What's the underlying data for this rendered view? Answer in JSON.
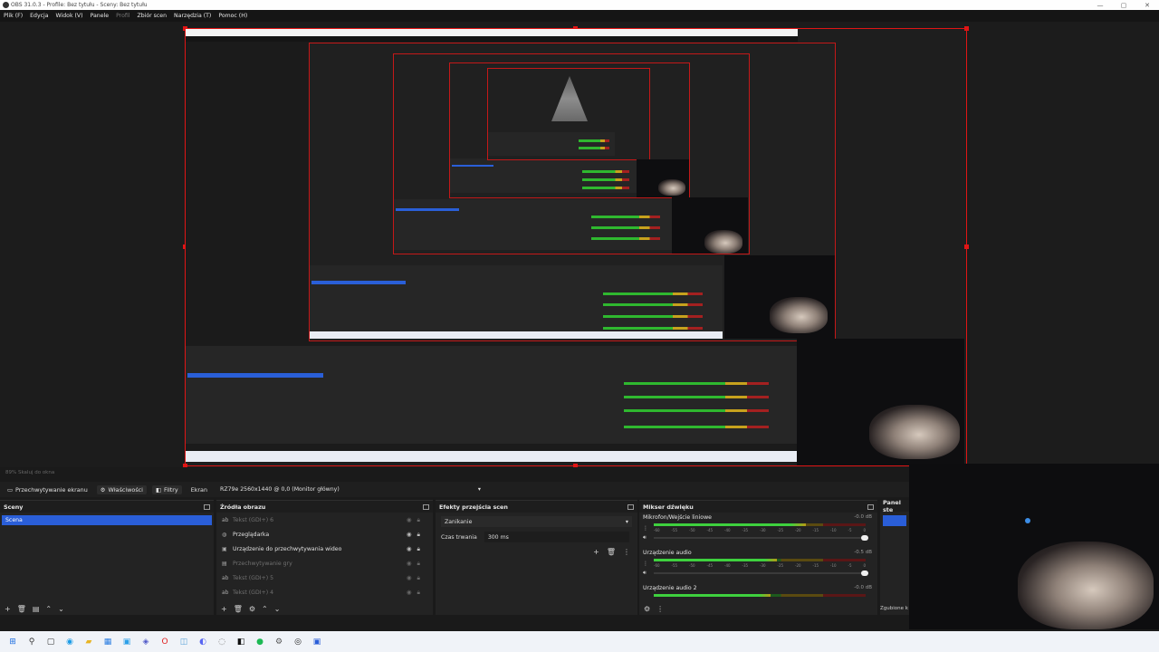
{
  "window": {
    "title": "OBS 31.0.3 - Profile: Bez tytułu - Sceny: Bez tytułu",
    "controls": [
      "—",
      "▢",
      "✕"
    ]
  },
  "menu": {
    "items": [
      "Plik (F)",
      "Edycja",
      "Widok (V)",
      "Panele",
      "Profil",
      "Zbiór scen",
      "Narzędzia (T)",
      "Pomoc (H)"
    ]
  },
  "status_line": "89%   Skaluj do okna",
  "source_toolbar": {
    "source_name": "Przechwytywanie ekranu",
    "properties_label": "Właściwości",
    "filters_label": "Filtry",
    "screen_label": "Ekran",
    "monitor_value": "RZ79e 2560x1440 @ 0,0 (Monitor główny)"
  },
  "scenes": {
    "title": "Sceny",
    "items": [
      "Scena"
    ],
    "footer": [
      "+",
      "🗑",
      "▤",
      "⌃",
      "⌄"
    ]
  },
  "sources": {
    "title": "Źródła obrazu",
    "items": [
      {
        "label": "Tekst (GDI+) 6",
        "dim": true,
        "icon": "text-icon"
      },
      {
        "label": "Przeglądarka",
        "dim": false,
        "icon": "browser-icon"
      },
      {
        "label": "Urządzenie do przechwytywania wideo",
        "dim": false,
        "icon": "camera-icon"
      },
      {
        "label": "Przechwytywanie gry",
        "dim": true,
        "icon": "gamepad-icon"
      },
      {
        "label": "Tekst (GDI+) 5",
        "dim": true,
        "icon": "text-icon"
      },
      {
        "label": "Tekst (GDI+) 4",
        "dim": true,
        "icon": "text-icon"
      }
    ],
    "footer": [
      "+",
      "🗑",
      "⚙",
      "⌃",
      "⌄"
    ]
  },
  "transitions": {
    "title": "Efekty przejścia scen",
    "selected": "Zanikanie",
    "duration_label": "Czas trwania",
    "duration_value": "300 ms"
  },
  "mixer": {
    "title": "Mikser dźwięku",
    "ticks": [
      "-60",
      "-55",
      "-50",
      "-45",
      "-40",
      "-35",
      "-30",
      "-25",
      "-20",
      "-15",
      "-10",
      "-5",
      "0"
    ],
    "channels": [
      {
        "name": "Mikrofon/Wejście liniowe",
        "db": "-0.0 dB",
        "level": 0.72
      },
      {
        "name": "Urządzenie audio",
        "db": "-0.5 dB",
        "level": 0.58
      },
      {
        "name": "Urządzenie audio 2",
        "db": "-0.0 dB",
        "level": 0.55
      }
    ]
  },
  "control_panel": {
    "title": "Panel ste",
    "docked_label": "Zgubione k"
  },
  "colors": {
    "accent_blue": "#2a5ed8",
    "preview_outline_red": "#e01515",
    "meter_green": "#3ed13e"
  },
  "taskbar": {
    "icons": [
      "windows-icon",
      "search-icon",
      "taskview-icon",
      "edge-icon",
      "file-explorer-icon",
      "store-icon",
      "photos-icon",
      "teams-icon",
      "opera-icon",
      "app-icon",
      "discord-icon",
      "app-icon",
      "capcut-icon",
      "spotify-icon",
      "steam-icon",
      "obs-icon",
      "app-icon"
    ]
  }
}
